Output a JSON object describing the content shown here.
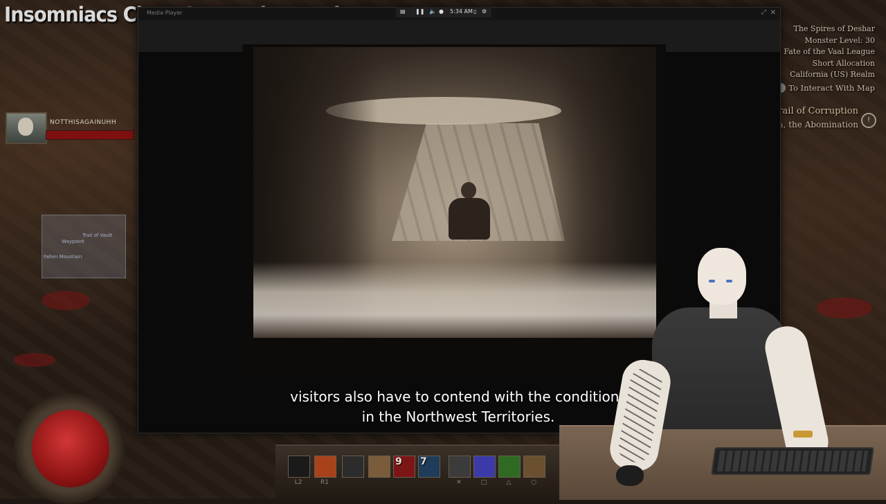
{
  "stream": {
    "title": "Insomniacs Chat: Any topic, anytime."
  },
  "player": {
    "name": "NOTTHISAGAINUHH"
  },
  "minimap": {
    "labels": [
      "Waypoint",
      "Trail of Vault",
      "Fallen Mountain"
    ]
  },
  "zone": {
    "name": "The Spires of Deshar",
    "monster_level": "Monster Level: 30",
    "league": "HC Fate of the Vaal League",
    "allocation": "Short Allocation",
    "realm": "California (US) Realm",
    "map_hint": "To Interact With Map"
  },
  "quest": {
    "title": "Trail of Corruption",
    "subtitle": "ara, the Abomination",
    "icon": "quest-marker-icon"
  },
  "window": {
    "title": "Media Player",
    "time": "5:34 AM"
  },
  "skillbar": {
    "slots": [
      {
        "icon": "empty-slot-icon",
        "color": "#1a1a1a",
        "key": "L2"
      },
      {
        "icon": "fire-skill-icon",
        "color": "#a8421a",
        "key": "R1"
      },
      {
        "icon": "swap-icon",
        "color": "#2c2c2c",
        "key": ""
      },
      {
        "icon": "beast-skill-icon",
        "color": "#7a5c3a",
        "key": ""
      },
      {
        "icon": "blood-skill-icon",
        "color": "#7c1616",
        "key": "",
        "count": "9"
      },
      {
        "icon": "shadow-skill-icon",
        "color": "#1f3c5a",
        "key": "",
        "count": "7"
      },
      {
        "icon": "claw-skill-icon",
        "color": "#3b3b3b",
        "key": ""
      },
      {
        "icon": "storm-skill-icon",
        "color": "#3b3aa8",
        "key": ""
      },
      {
        "icon": "poison-skill-icon",
        "color": "#2f6a22",
        "key": ""
      },
      {
        "icon": "summon-skill-icon",
        "color": "#6a5030",
        "key": ""
      }
    ]
  },
  "subtitle": {
    "line1": "visitors also have to contend with the conditions",
    "line2": "in the Northwest Territories."
  },
  "colors": {
    "life": "#b51f1f",
    "text_zone": "#c6b9a8",
    "quest": "#cdb89a"
  }
}
